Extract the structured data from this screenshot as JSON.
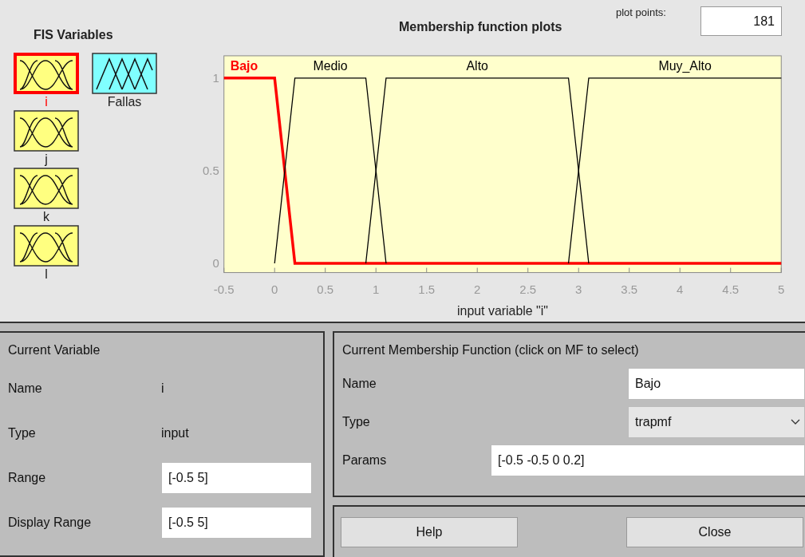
{
  "fis_variables": {
    "title": "FIS Variables",
    "items": [
      {
        "name": "i",
        "kind": "input",
        "selected": true
      },
      {
        "name": "Fallas",
        "kind": "output",
        "selected": false
      },
      {
        "name": "j",
        "kind": "input",
        "selected": false
      },
      {
        "name": "k",
        "kind": "input",
        "selected": false
      },
      {
        "name": "l",
        "kind": "input",
        "selected": false
      }
    ]
  },
  "plot": {
    "plot_points_label": "plot points:",
    "plot_points": "181",
    "chart_data": {
      "type": "line",
      "title": "Membership function plots",
      "xlabel": "input variable \"i\"",
      "x": [
        -0.5,
        0,
        0.2,
        0.9,
        1.1,
        2.9,
        3.1,
        5
      ],
      "xlim": [
        -0.5,
        5
      ],
      "ylim": [
        -0.05,
        1.12
      ],
      "xticks": [
        -0.5,
        0,
        0.5,
        1,
        1.5,
        2,
        2.5,
        3,
        3.5,
        4,
        4.5,
        5
      ],
      "yticks": [
        0,
        0.5,
        1
      ],
      "series": [
        {
          "name": "Bajo",
          "color": "#ff0000",
          "values": [
            1,
            1,
            0,
            0,
            0,
            0,
            0,
            0
          ]
        },
        {
          "name": "Medio",
          "color": "#000000",
          "values": [
            null,
            0,
            1,
            1,
            0,
            null,
            null,
            null
          ]
        },
        {
          "name": "Alto",
          "color": "#000000",
          "values": [
            null,
            null,
            null,
            0,
            1,
            1,
            0,
            null
          ]
        },
        {
          "name": "Muy_Alto",
          "color": "#000000",
          "values": [
            null,
            null,
            null,
            null,
            null,
            0,
            1,
            1
          ]
        }
      ]
    }
  },
  "current_variable": {
    "title": "Current Variable",
    "name_label": "Name",
    "name": "i",
    "type_label": "Type",
    "type": "input",
    "range_label": "Range",
    "range": "[-0.5 5]",
    "display_range_label": "Display Range",
    "display_range": "[-0.5 5]"
  },
  "current_mf": {
    "title": "Current Membership Function (click on MF to select)",
    "name_label": "Name",
    "name": "Bajo",
    "type_label": "Type",
    "type": "trapmf",
    "params_label": "Params",
    "params": "[-0.5 -0.5 0 0.2]"
  },
  "buttons": [
    "Help",
    "Close"
  ]
}
